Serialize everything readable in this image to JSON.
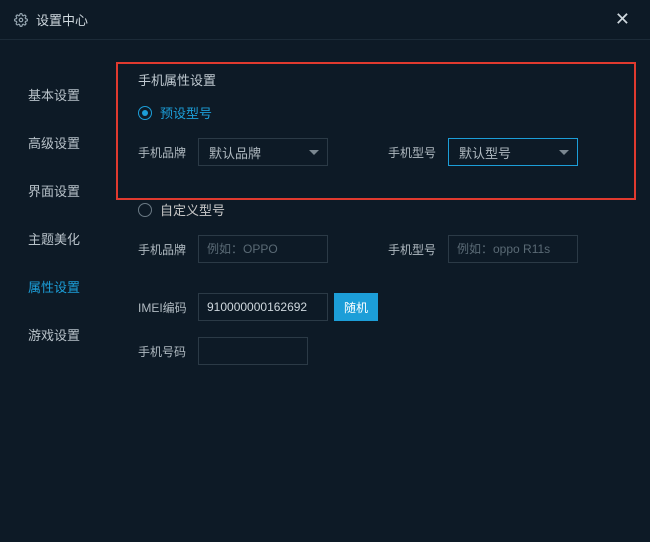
{
  "titlebar": {
    "title": "设置中心"
  },
  "sidebar": {
    "items": [
      {
        "label": "基本设置"
      },
      {
        "label": "高级设置"
      },
      {
        "label": "界面设置"
      },
      {
        "label": "主题美化"
      },
      {
        "label": "属性设置"
      },
      {
        "label": "游戏设置"
      }
    ]
  },
  "section": {
    "heading": "手机属性设置",
    "preset_radio": "预设型号",
    "custom_radio": "自定义型号",
    "brand_label": "手机品牌",
    "model_label": "手机型号",
    "brand_select": "默认品牌",
    "model_select": "默认型号",
    "brand_placeholder": "例如：OPPO",
    "model_placeholder": "例如：oppo R11s",
    "imei_label": "IMEI编码",
    "imei_value": "910000000162692",
    "random_btn": "随机",
    "phoneno_label": "手机号码",
    "phoneno_value": ""
  }
}
